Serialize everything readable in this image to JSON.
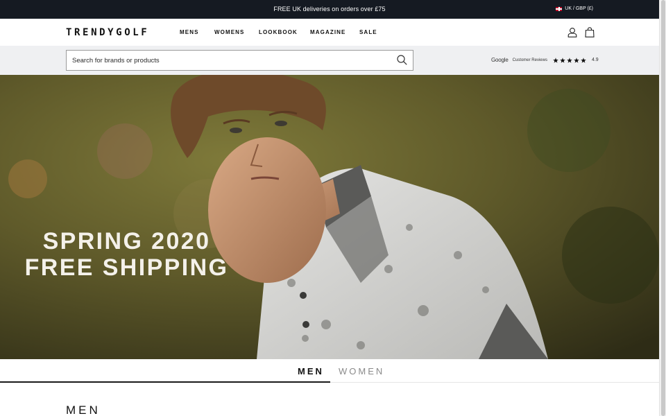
{
  "announcement": {
    "text": "FREE UK deliveries on orders over £75",
    "locale": "UK / GBP (£)"
  },
  "header": {
    "logo": "TRENDYGOLF",
    "nav": [
      "MENS",
      "WOMENS",
      "LOOKBOOK",
      "MAGAZINE",
      "SALE"
    ],
    "icons": [
      "account-icon",
      "shopping-bag-icon"
    ]
  },
  "search": {
    "placeholder": "Search for brands or products",
    "value": ""
  },
  "reviews": {
    "brand": "Google",
    "label": "Customer Reviews",
    "stars": 5,
    "rating": "4.9"
  },
  "hero": {
    "line1": "SPRING 2020",
    "line2": "FREE SHIPPING"
  },
  "tabs": {
    "men": "MEN",
    "women": "WOMEN",
    "active": "men"
  },
  "section": {
    "title": "MEN"
  },
  "colors": {
    "announce_bg": "#151a22",
    "search_band_bg": "#eff0f2",
    "hero_text": "#f4f1ea",
    "tab_inactive": "#8a8a8a"
  }
}
